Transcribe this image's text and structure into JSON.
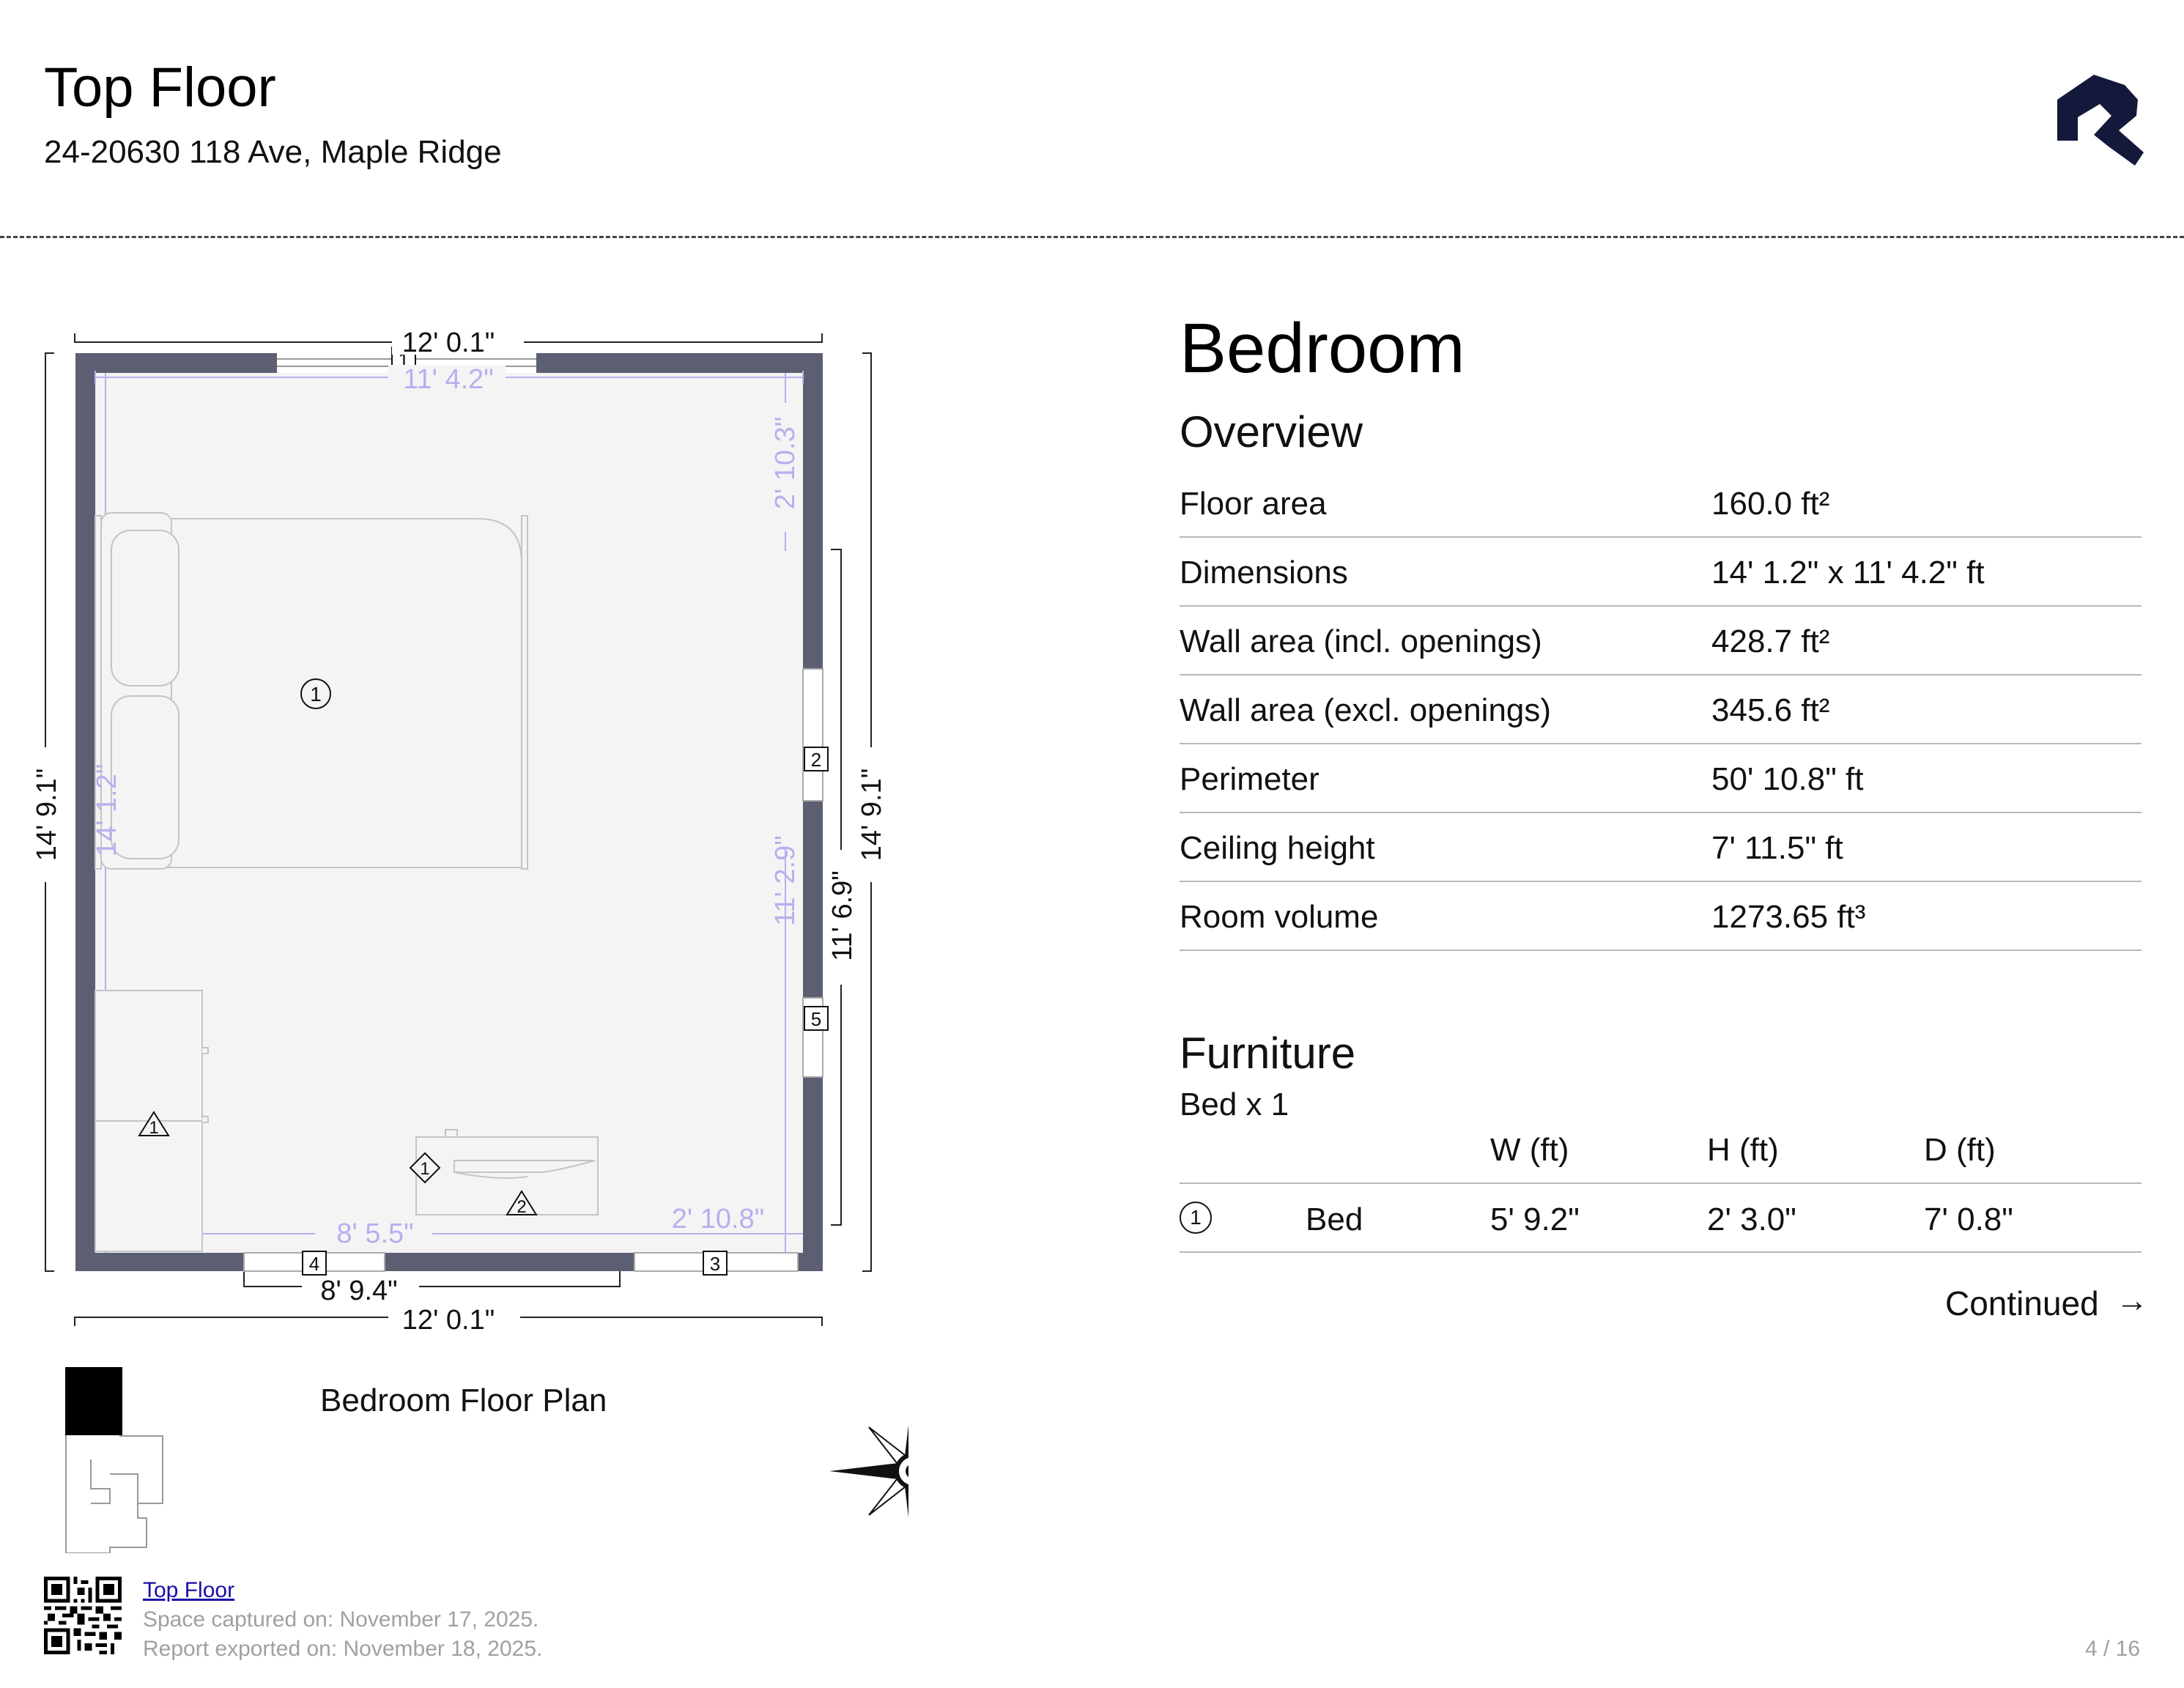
{
  "header": {
    "title": "Top Floor",
    "address": "24-20630 118 Ave, Maple Ridge"
  },
  "colors": {
    "wall": "#5c5f72",
    "floor": "#f4f4f4",
    "inner_dimension": "#b5b0ee",
    "logo": "#14183a"
  },
  "floor_plan": {
    "caption": "Bedroom Floor Plan",
    "dimensions": {
      "top_outer": "12' 0.1\"",
      "bottom_outer": "12' 0.1\"",
      "left_outer": "14' 9.1\"",
      "right_outer": "14' 9.1\"",
      "inner_width": "11' 4.2\"",
      "inner_height": "14' 1.2\"",
      "right_upper": "2' 10.3\"",
      "right_lower": "11' 2.9\"",
      "right_wall_segment": "11' 6.9\"",
      "bottom_left_inner": "8' 5.5\"",
      "bottom_right_inner": "2' 10.8\"",
      "bottom_segment": "8' 9.4\""
    },
    "openings": [
      "1",
      "2",
      "3",
      "4",
      "5"
    ],
    "furniture_markers": [
      "1"
    ],
    "triangle_markers": [
      "1",
      "2"
    ],
    "diamond_markers": [
      "1"
    ],
    "compass_label": "N"
  },
  "room": {
    "name": "Bedroom",
    "overview_heading": "Overview",
    "overview": [
      {
        "label": "Floor area",
        "value": "160.0 ft²"
      },
      {
        "label": "Dimensions",
        "value": "14' 1.2\" x 11' 4.2\" ft"
      },
      {
        "label": "Wall area (incl. openings)",
        "value": "428.7 ft²"
      },
      {
        "label": "Wall area (excl. openings)",
        "value": "345.6 ft²"
      },
      {
        "label": "Perimeter",
        "value": "50' 10.8\" ft"
      },
      {
        "label": "Ceiling height",
        "value": "7' 11.5\" ft"
      },
      {
        "label": "Room volume",
        "value": "1273.65 ft³"
      }
    ]
  },
  "furniture": {
    "heading": "Furniture",
    "group": "Bed x 1",
    "columns": [
      "W (ft)",
      "H (ft)",
      "D (ft)"
    ],
    "rows": [
      {
        "marker": "1",
        "name": "Bed",
        "w": "5' 9.2\"",
        "h": "2' 3.0\"",
        "d": "7' 0.8\""
      }
    ],
    "continued_label": "Continued",
    "continued_arrow": "→"
  },
  "footer": {
    "link_text": "Top Floor",
    "captured": "Space captured on: November 17, 2025.",
    "exported": "Report exported on: November 18, 2025.",
    "page_number": "4 / 16"
  }
}
